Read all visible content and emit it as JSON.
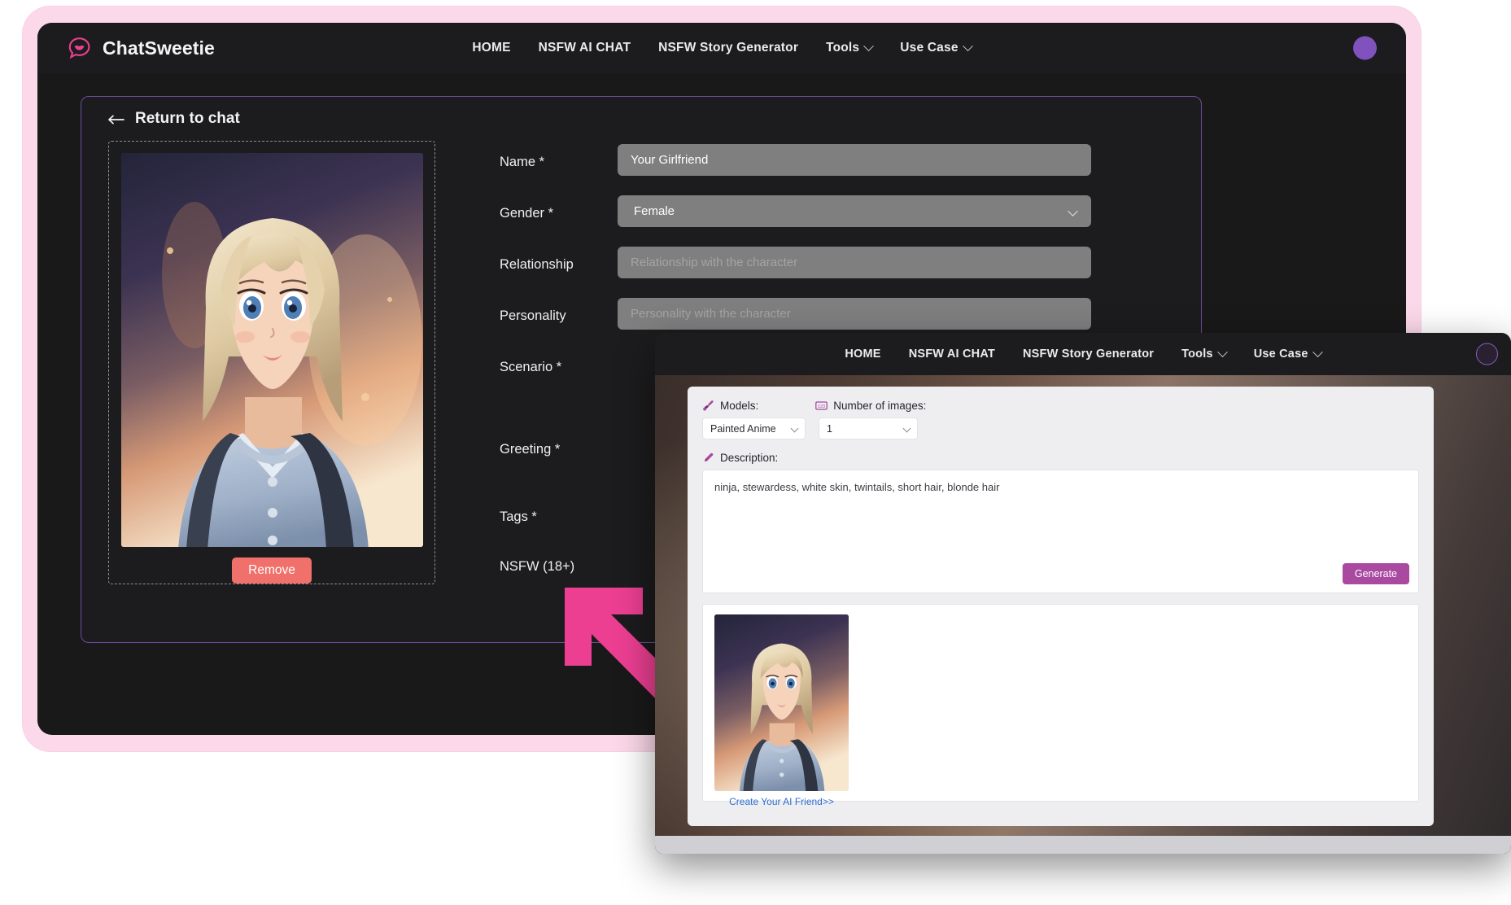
{
  "brand": {
    "name": "ChatSweetie",
    "logo_icon": "chat-lips-icon",
    "accent": "#ec3f92"
  },
  "nav": {
    "links": [
      {
        "label": "HOME",
        "dropdown": false
      },
      {
        "label": "NSFW AI CHAT",
        "dropdown": false
      },
      {
        "label": "NSFW Story Generator",
        "dropdown": false
      },
      {
        "label": "Tools",
        "dropdown": true
      },
      {
        "label": "Use Case",
        "dropdown": true
      }
    ],
    "avatar_icon": "avatar-icon",
    "avatar_color": "#7f52bd"
  },
  "page": {
    "back_label": "Return to chat",
    "back_icon": "arrow-left-icon",
    "image_panel": {
      "remove_label": "Remove",
      "remove_color": "#f0706b",
      "image_alt": "anime-character-portrait"
    },
    "form": {
      "rows": [
        {
          "label": "Name *",
          "value": "Your Girlfriend",
          "placeholder": "",
          "type": "text",
          "filled": true
        },
        {
          "label": "Gender *",
          "value": "Female",
          "placeholder": "",
          "type": "select",
          "filled": true
        },
        {
          "label": "Relationship",
          "value": "",
          "placeholder": "Relationship with the character",
          "type": "text",
          "filled": false
        },
        {
          "label": "Personality",
          "value": "",
          "placeholder": "Personality with the character",
          "type": "text",
          "filled": false
        },
        {
          "label": "Scenario *",
          "value": "",
          "placeholder": "",
          "type": "text",
          "filled": false
        },
        {
          "label": "Greeting *",
          "value": "",
          "placeholder": "",
          "type": "text",
          "filled": false
        },
        {
          "label": "Tags *",
          "value": "",
          "placeholder": "",
          "type": "text",
          "filled": false
        },
        {
          "label": "NSFW (18+)",
          "value": "",
          "placeholder": "",
          "type": "text",
          "filled": false
        }
      ]
    }
  },
  "annotation": {
    "arrow_icon": "arrow-up-left-icon",
    "color": "#ec3f92"
  },
  "generator_window": {
    "nav": {
      "links": [
        {
          "label": "HOME",
          "dropdown": false
        },
        {
          "label": "NSFW AI CHAT",
          "dropdown": false
        },
        {
          "label": "NSFW Story Generator",
          "dropdown": false
        },
        {
          "label": "Tools",
          "dropdown": true
        },
        {
          "label": "Use Case",
          "dropdown": true
        }
      ]
    },
    "models": {
      "label": "Models:",
      "icon": "paintbrush-icon",
      "value": "Painted Anime"
    },
    "number_of_images": {
      "label": "Number of images:",
      "icon": "number-123-icon",
      "value": "1"
    },
    "description": {
      "label": "Description:",
      "icon": "pencil-icon",
      "value": "ninja, stewardess, white skin, twintails, short hair, blonde hair"
    },
    "generate_label": "Generate",
    "generate_color": "#a9499f",
    "result": {
      "thumb_alt": "generated-anime-portrait",
      "link_label": "Create Your AI Friend>>",
      "link_color": "#2f6fd0"
    }
  }
}
